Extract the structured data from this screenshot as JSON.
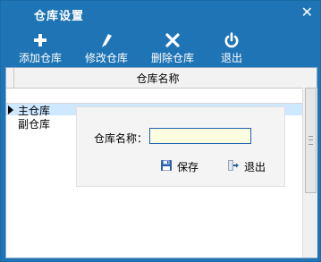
{
  "window": {
    "title": "仓库设置",
    "close_glyph": "✕"
  },
  "toolbar": {
    "add_label": "添加仓库",
    "edit_label": "修改仓库",
    "delete_label": "删除仓库",
    "exit_label": "退出"
  },
  "grid": {
    "column_header": "仓库名称",
    "rows": [
      {
        "name": "主仓库",
        "selected": true
      },
      {
        "name": "副仓库",
        "selected": false
      }
    ]
  },
  "dialog": {
    "field_label": "仓库名称：",
    "field_value": "",
    "save_label": "保存",
    "exit_label": "退出"
  },
  "colors": {
    "title_bar": "#1e74b5",
    "selected_row": "#cde8ff",
    "input_bg": "#fffde0"
  }
}
